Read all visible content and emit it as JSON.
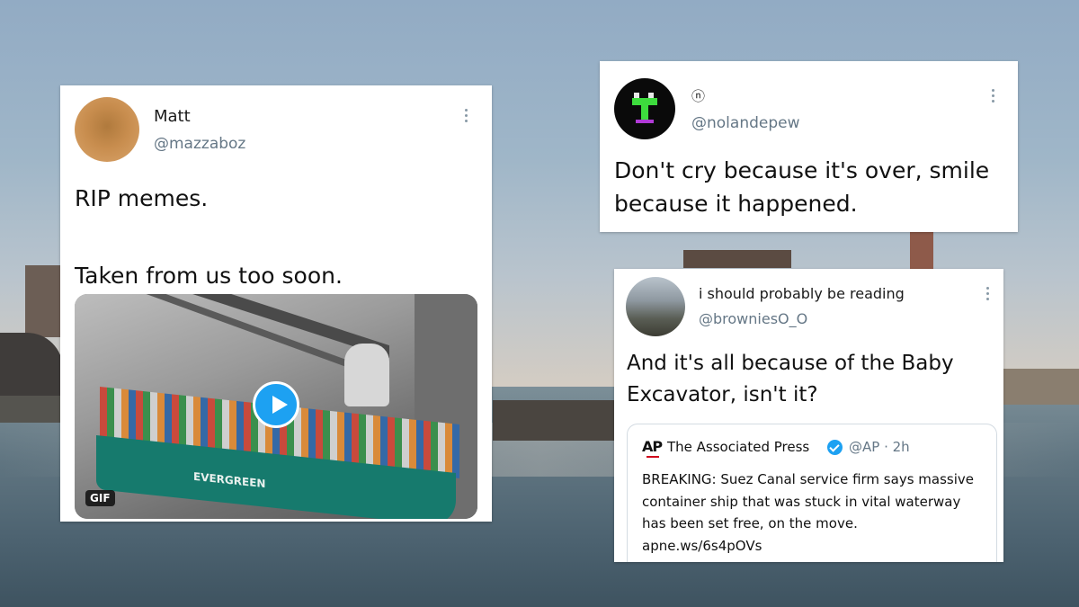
{
  "tweets": [
    {
      "name": "Matt",
      "handle": "@mazzaboz",
      "text": "RIP memes.\n\nTaken from us too soon.",
      "media": {
        "badge": "GIF",
        "ship_label": "EVERGREEN"
      }
    },
    {
      "name": "ⓝ",
      "handle": "@nolandepew",
      "text": "Don't cry because it's over, smile because it happened."
    },
    {
      "name": "i should probably be reading",
      "handle": "@browniesO_O",
      "text": "And it's all because of the Baby Excavator, isn't it?",
      "quoted": {
        "logo": "AP",
        "name": "The Associated Press",
        "meta": "@AP · 2h",
        "text": "BREAKING: Suez Canal service firm says massive container ship that was stuck in vital waterway has been set free, on the move.\napne.ws/6s4pOVs"
      }
    }
  ],
  "colors": {
    "accent": "#1da1f2",
    "handle_gray": "#657786",
    "ap_red": "#d0021b"
  },
  "icons": [
    "more-options-icon",
    "play-icon",
    "verified-badge-icon"
  ]
}
